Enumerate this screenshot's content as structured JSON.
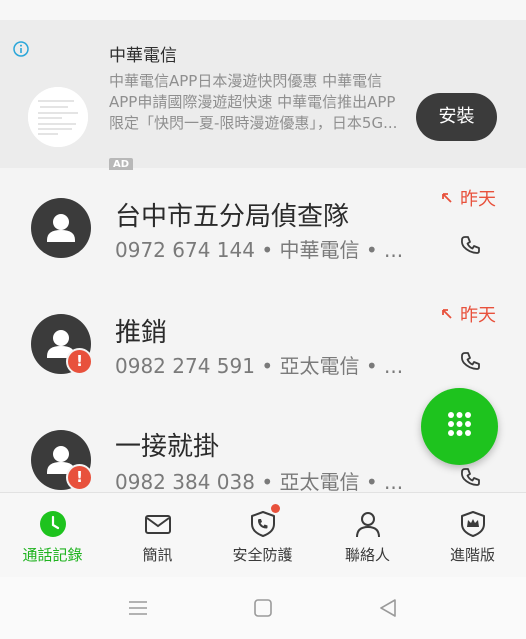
{
  "ad": {
    "title": "中華電信",
    "desc_lines": [
      "中華電信APP日本漫遊快閃優惠 中華電信",
      "APP申請國際漫遊超快速 中華電信推出APP",
      "限定「快閃一夏-限時漫遊優惠」，日本5G..."
    ],
    "badge": "AD",
    "install_label": "安裝"
  },
  "calls": [
    {
      "name": "台中市五分局偵查隊",
      "detail": "0972 674 144 • 中華電信 • ...",
      "time": "昨天",
      "flagged": false
    },
    {
      "name": "推銷",
      "detail": "0982 274 591 • 亞太電信 • ...",
      "time": "昨天",
      "flagged": true
    },
    {
      "name": "一接就掛",
      "detail": "0982 384 038 • 亞太電信 • ...",
      "time": "",
      "flagged": true
    }
  ],
  "tabs": [
    {
      "label": "通話記錄",
      "icon": "clock-icon",
      "active": true
    },
    {
      "label": "簡訊",
      "icon": "envelope-icon",
      "active": false
    },
    {
      "label": "安全防護",
      "icon": "shield-phone-icon",
      "active": false,
      "badge": true
    },
    {
      "label": "聯絡人",
      "icon": "person-icon",
      "active": false
    },
    {
      "label": "進階版",
      "icon": "crown-shield-icon",
      "active": false
    }
  ],
  "colors": {
    "accent": "#1ec31e",
    "warning": "#e8513c",
    "dark": "#3b3b3b"
  }
}
